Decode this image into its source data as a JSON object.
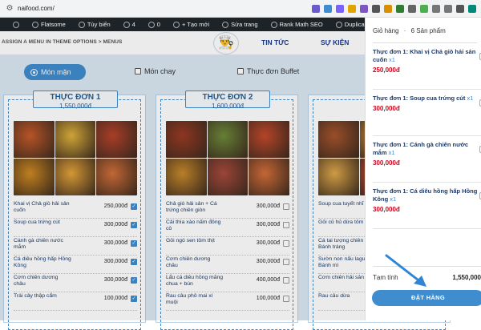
{
  "browser": {
    "url": "naifood.com/",
    "extensions": [
      {
        "icon": "puzzle-icon",
        "color": "#6a5acd"
      },
      {
        "icon": "a-icon",
        "color": "#3f8ccf"
      },
      {
        "icon": "d-icon",
        "color": "#7b61ff"
      },
      {
        "icon": "m-icon",
        "color": "#e2a400"
      },
      {
        "icon": "x-icon",
        "color": "#7e57c2"
      },
      {
        "icon": "code-icon",
        "color": "#555555"
      },
      {
        "icon": "star-icon",
        "color": "#d99000"
      },
      {
        "icon": "green-ext-icon",
        "color": "#2e7d32"
      },
      {
        "icon": "chat-icon",
        "color": "#666666"
      },
      {
        "icon": "leaf-icon",
        "color": "#4caf50"
      },
      {
        "icon": "gear-icon",
        "color": "#777777"
      },
      {
        "icon": "extension-icon",
        "color": "#777777"
      },
      {
        "icon": "download-icon",
        "color": "#555555"
      },
      {
        "icon": "avatar-icon",
        "color": "#00897b"
      }
    ]
  },
  "wpbar": {
    "items": [
      {
        "icon": "wordpress-icon",
        "label": ""
      },
      {
        "icon": "flatsome-icon",
        "label": "Flatsome"
      },
      {
        "icon": "customize-icon",
        "label": "Tùy biến"
      },
      {
        "icon": "updates-icon",
        "label": "4"
      },
      {
        "icon": "comments-icon",
        "label": "0"
      },
      {
        "icon": "plus-icon",
        "label": "+ Tạo mới"
      },
      {
        "icon": "edit-icon",
        "label": "Sửa trang"
      },
      {
        "icon": "rankmath-icon",
        "label": "Rank Math SEO"
      },
      {
        "icon": "duplicate-icon",
        "label": "Duplicate Post"
      }
    ]
  },
  "header": {
    "menu_notice": "ASSIGN A MENU IN THEME OPTIONS > MENUS",
    "nav": [
      "TIN TỨC",
      "SỰ KIỆN"
    ]
  },
  "tabs": {
    "active": "Món mặn",
    "options": [
      "Món chay",
      "Thực đơn Buffet"
    ]
  },
  "menus": [
    {
      "title": "THỰC ĐƠN 1",
      "price": "1,550,000đ",
      "items": [
        {
          "name": "Khai vị Chả giò hải sản cuốn",
          "price": "250,000đ",
          "checked": true
        },
        {
          "name": "Soup cua trứng cút",
          "price": "300,000đ",
          "checked": true
        },
        {
          "name": "Cánh gà chiên nước mắm",
          "price": "300,000đ",
          "checked": true
        },
        {
          "name": "Cá diêu hồng hấp Hồng Kông",
          "price": "300,000đ",
          "checked": true
        },
        {
          "name": "Cơm chiên dương châu",
          "price": "300,000đ",
          "checked": true
        },
        {
          "name": "Trái cây thập cẩm",
          "price": "100,000đ",
          "checked": true
        }
      ]
    },
    {
      "title": "THỰC ĐƠN 2",
      "price": "1,600,000đ",
      "items": [
        {
          "name": "Chả giò hải sản + Cá trứng chiên giòn",
          "price": "300,000đ",
          "checked": false
        },
        {
          "name": "Cải thìa xào nấm đông cô",
          "price": "300,000đ",
          "checked": false
        },
        {
          "name": "Gỏi ngó sen tôm thịt",
          "price": "300,000đ",
          "checked": false
        },
        {
          "name": "Cơm chiên dương châu",
          "price": "300,000đ",
          "checked": false
        },
        {
          "name": "Lẩu cá diêu hồng măng chua + bún",
          "price": "400,000đ",
          "checked": false
        },
        {
          "name": "Rau câu phô mai xí muội",
          "price": "100,000đ",
          "checked": false
        }
      ]
    },
    {
      "title": "",
      "price": "",
      "items": [
        {
          "name": "Soup cua tuyết nhĩ",
          "price": "",
          "checked": false
        },
        {
          "name": "Gỏi củ hủ dừa tôm thịt",
          "price": "",
          "checked": false
        },
        {
          "name": "Cá tai tượng chiên Bánh tráng",
          "price": "",
          "checked": false
        },
        {
          "name": "Sườn non nấu lagu Bánh mì",
          "price": "",
          "checked": false
        },
        {
          "name": "Cơm chiên hải sản",
          "price": "",
          "checked": false
        },
        {
          "name": "Rau câu dừa",
          "price": "",
          "checked": false
        }
      ]
    }
  ],
  "cart": {
    "label": "Giỏ hàng",
    "separator": "·",
    "count": "6 Sản phẩm",
    "items": [
      {
        "name": "Thực đơn 1: Khai vị Chả giò hải sản cuốn",
        "qty": "x1",
        "price": "250,000đ"
      },
      {
        "name": "Thực đơn 1: Soup cua trứng cút",
        "qty": "x1",
        "price": "300,000đ"
      },
      {
        "name": "Thực đơn 1: Cánh gà chiên nước mắm",
        "qty": "x1",
        "price": "300,000đ"
      },
      {
        "name": "Thực đơn 1: Cá diêu hồng hấp Hồng Kông",
        "qty": "x1",
        "price": "300,000đ"
      }
    ],
    "subtotal_label": "Tạm tính",
    "subtotal_value": "1,550,000",
    "order_button": "ĐẶT HÀNG"
  },
  "colors": {
    "accent": "#3f8ccf",
    "navy": "#1f3c88",
    "price_red": "#d0021b",
    "wp_bar": "#1d2327"
  }
}
